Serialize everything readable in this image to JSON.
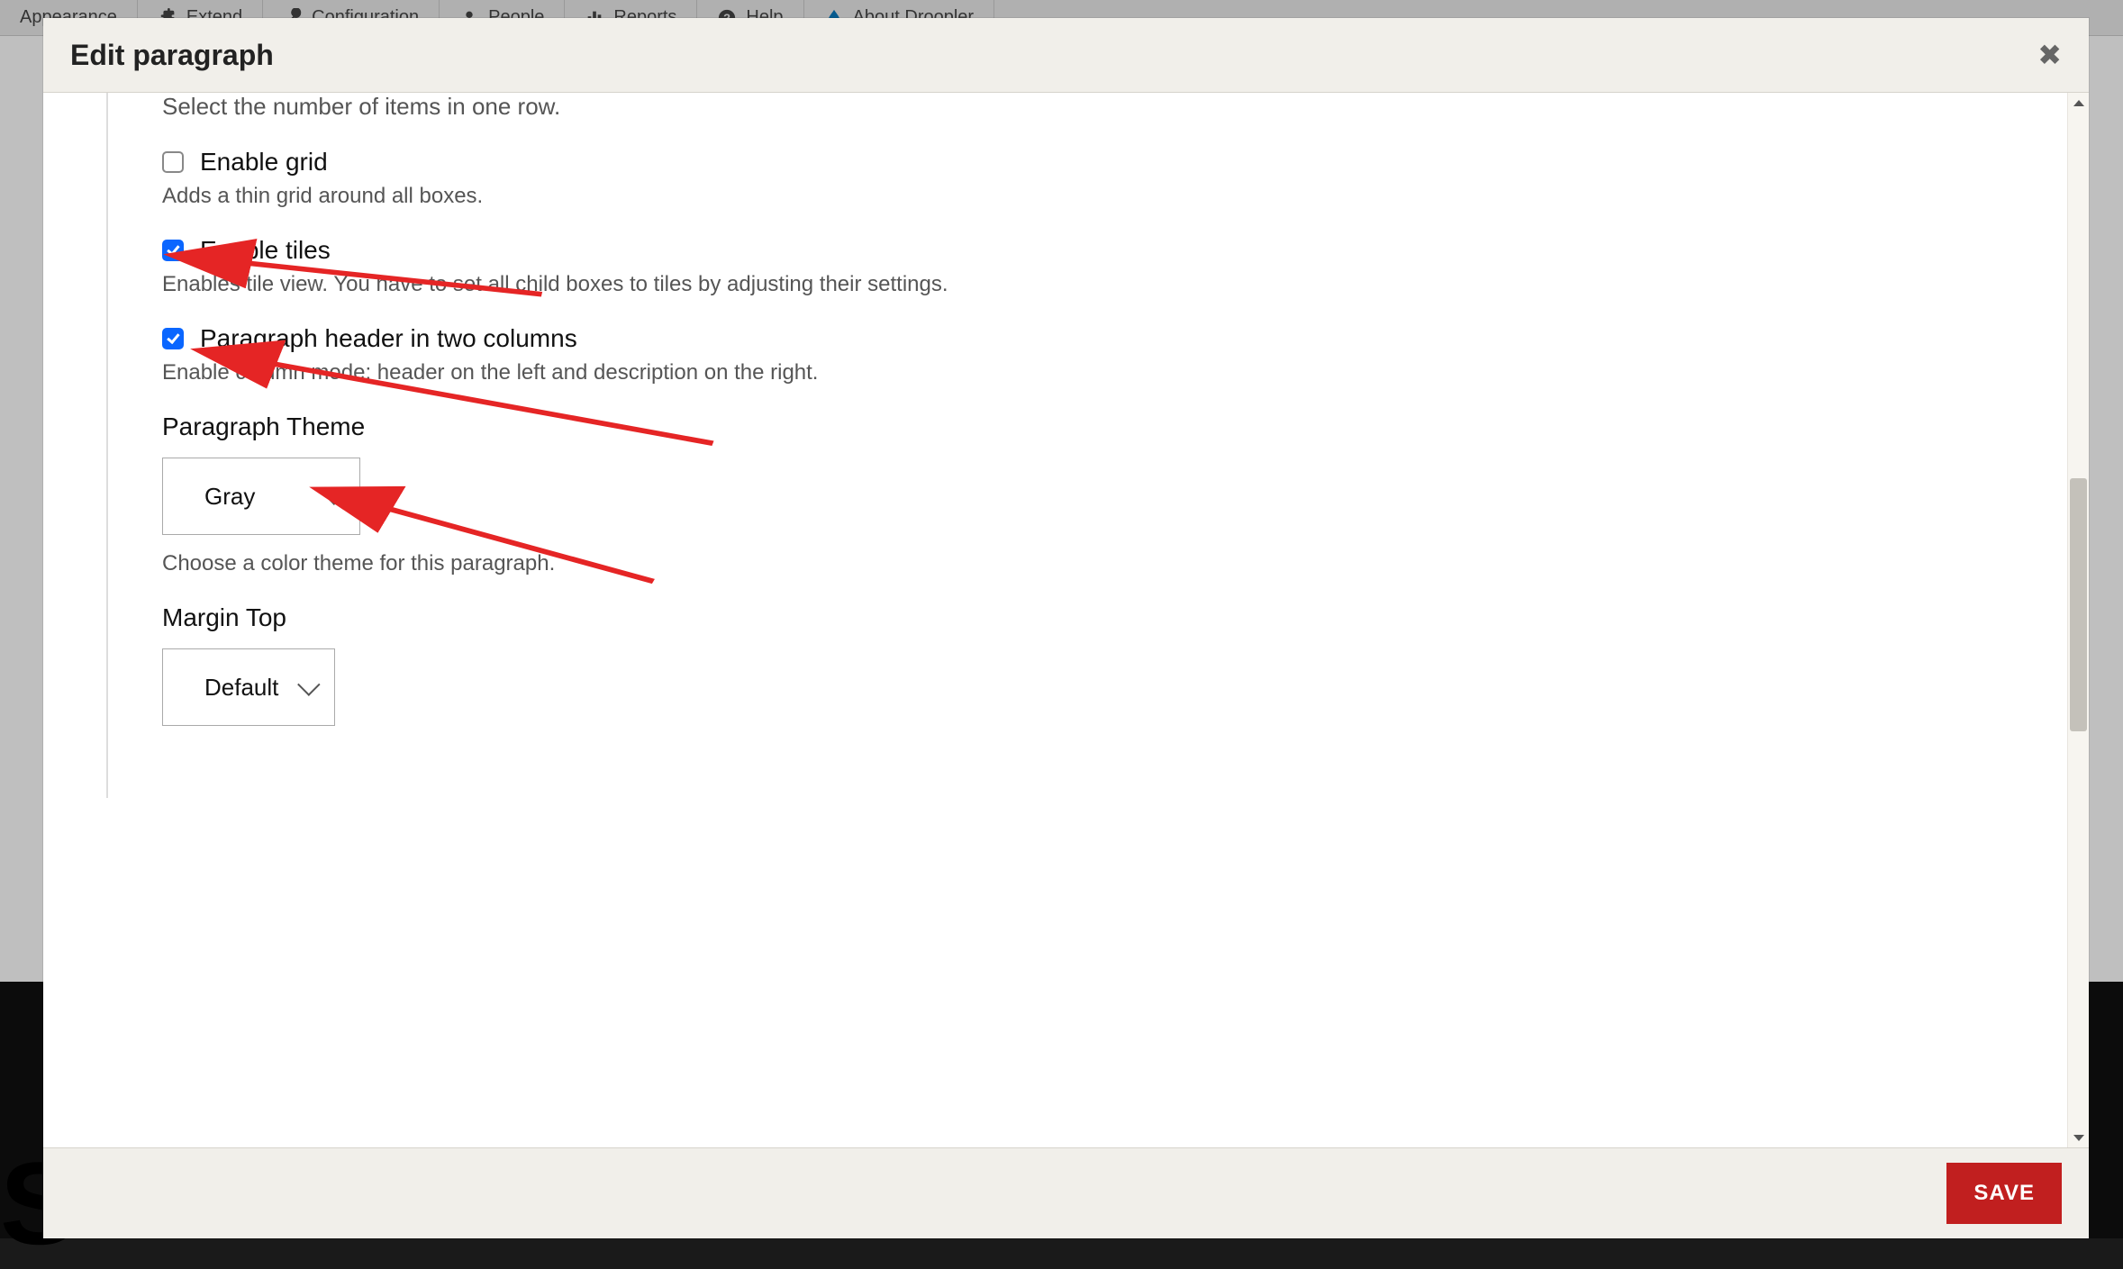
{
  "admin_menu": {
    "appearance": "Appearance",
    "extend": "Extend",
    "configuration": "Configuration",
    "people": "People",
    "reports": "Reports",
    "help": "Help",
    "about": "About Droopler"
  },
  "modal": {
    "title": "Edit paragraph",
    "save_label": "SAVE"
  },
  "form": {
    "items_hint": "Select the number of items in one row.",
    "enable_grid": {
      "label": "Enable grid",
      "help": "Adds a thin grid around all boxes."
    },
    "enable_tiles": {
      "label": "Enable tiles",
      "help": "Enables tile view. You have to set all child boxes to tiles by adjusting their settings."
    },
    "two_cols": {
      "label": "Paragraph header in two columns",
      "help": "Enable column mode: header on the left and description on the right."
    },
    "theme": {
      "label": "Paragraph Theme",
      "value": "Gray",
      "help": "Choose a color theme for this paragraph."
    },
    "margin_top": {
      "label": "Margin Top",
      "value": "Default"
    }
  }
}
